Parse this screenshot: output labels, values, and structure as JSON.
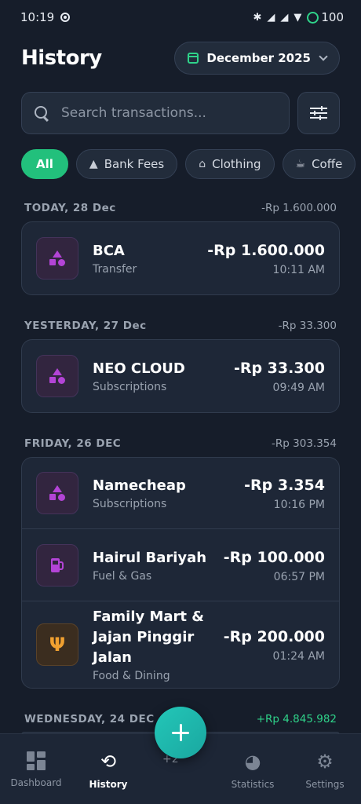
{
  "status_bar": {
    "time": "10:19",
    "battery": "100"
  },
  "header": {
    "title": "History",
    "month": "December 2025"
  },
  "search": {
    "placeholder": "Search transactions..."
  },
  "chips": [
    {
      "label": "All",
      "icon": ""
    },
    {
      "label": "Bank Fees",
      "icon": "shapes-icon"
    },
    {
      "label": "Clothing",
      "icon": "hanger-icon"
    },
    {
      "label": "Coffe",
      "icon": "cup-icon"
    }
  ],
  "groups": [
    {
      "label": "TODAY, 28 Dec",
      "total": "-Rp 1.600.000",
      "items": [
        {
          "name": "BCA",
          "category": "Transfer",
          "amount": "-Rp 1.600.000",
          "time": "10:11 AM",
          "icon": "shapes-icon"
        }
      ]
    },
    {
      "label": "YESTERDAY, 27 Dec",
      "total": "-Rp 33.300",
      "items": [
        {
          "name": "NEO CLOUD",
          "category": "Subscriptions",
          "amount": "-Rp 33.300",
          "time": "09:49 AM",
          "icon": "shapes-icon"
        }
      ]
    },
    {
      "label": "FRIDAY, 26 DEC",
      "total": "-Rp 303.354",
      "items": [
        {
          "name": "Namecheap",
          "category": "Subscriptions",
          "amount": "-Rp 3.354",
          "time": "10:16 PM",
          "icon": "shapes-icon"
        },
        {
          "name": "Hairul Bariyah",
          "category": "Fuel & Gas",
          "amount": "-Rp 100.000",
          "time": "06:57 PM",
          "icon": "fuel-icon"
        },
        {
          "name": "Family Mart & Jajan Pinggir Jalan",
          "category": "Food & Dining",
          "amount": "-Rp 200.000",
          "time": "01:24 AM",
          "icon": "fork-knife-icon"
        }
      ]
    },
    {
      "label": "WEDNESDAY, 24 DEC",
      "total": "+Rp 4.845.982",
      "items": []
    }
  ],
  "fab": {
    "hint": "+2"
  },
  "nav": [
    {
      "label": "Dashboard",
      "icon": "dashboard-icon"
    },
    {
      "label": "History",
      "icon": "history-icon"
    },
    {
      "label": "Statistics",
      "icon": "pie-chart-icon"
    },
    {
      "label": "Settings",
      "icon": "gear-icon"
    }
  ],
  "colors": {
    "accent": "#22c07c",
    "background": "#161d2a",
    "card": "#1e2737",
    "icon_purple": "#b344d6",
    "icon_orange": "#f0a030"
  }
}
